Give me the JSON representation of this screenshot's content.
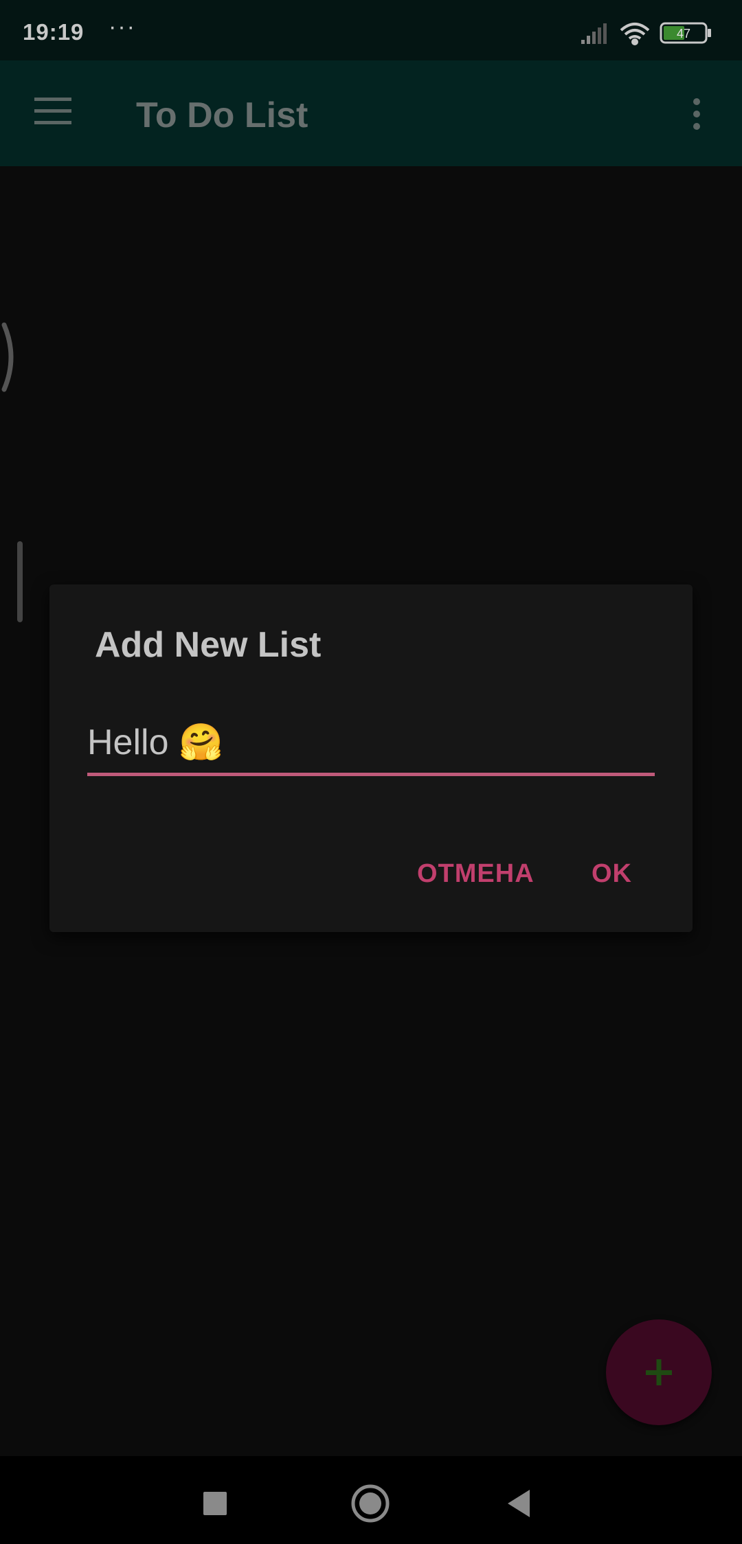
{
  "status_bar": {
    "time": "19:19",
    "overflow": "···",
    "battery": "47",
    "icons": [
      "signal-icon",
      "wifi-icon",
      "battery-icon"
    ]
  },
  "app_bar": {
    "title": "To Do List",
    "menu_icon": "menu-icon",
    "more_icon": "more-vert-icon",
    "color": "#032320"
  },
  "dialog": {
    "title": "Add New List",
    "input_value": "Hello 🤗",
    "cancel_label": "ОТМЕНА",
    "ok_label": "OK",
    "accent_color": "#c13f6d"
  },
  "fab": {
    "icon": "plus-icon",
    "color": "#3a0820"
  },
  "nav_bar": {
    "icons": [
      "recents-icon",
      "home-icon",
      "back-icon"
    ]
  }
}
